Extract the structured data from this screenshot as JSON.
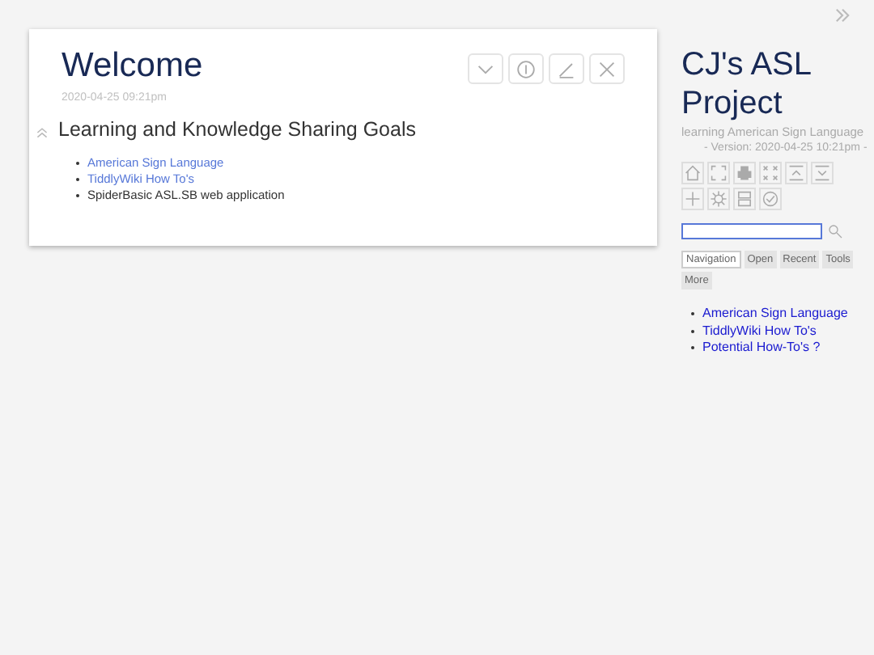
{
  "tiddler": {
    "title": "Welcome",
    "date": "2020-04-25 09:21pm",
    "heading": "Learning and Knowledge Sharing Goals",
    "items": [
      {
        "text": "American Sign Language",
        "kind": "link"
      },
      {
        "text": "TiddlyWiki How To's",
        "kind": "link"
      },
      {
        "text": "SpiderBasic ASL.SB web application",
        "kind": "text"
      }
    ]
  },
  "sidebar": {
    "title": "CJ's ASL Project",
    "subtitle": "learning American Sign Language",
    "version": "- Version: 2020-04-25 10:21pm -",
    "tabs": [
      {
        "label": "Navigation",
        "selected": true
      },
      {
        "label": "Open",
        "selected": false
      },
      {
        "label": "Recent",
        "selected": false
      },
      {
        "label": "Tools",
        "selected": false
      },
      {
        "label": "More",
        "selected": false
      }
    ],
    "links": [
      "American Sign Language",
      "TiddlyWiki How To's",
      "Potential How-To's ?"
    ]
  }
}
